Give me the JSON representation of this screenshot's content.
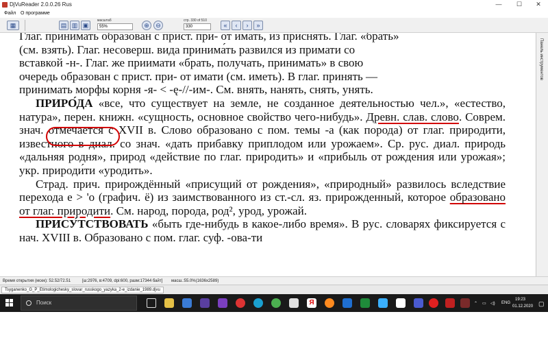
{
  "window": {
    "title": "DjVuReader 2.0.0.26 Rus"
  },
  "menu": {
    "file": "Файл",
    "about": "О программе"
  },
  "toolbar": {
    "zoom_label": "масштаб",
    "zoom_value": "55%",
    "page_label": "стр. 330 of 510",
    "page_value": "330"
  },
  "side_panel": {
    "label": "Панель инструментов"
  },
  "document": {
    "lines": [
      "Глаг. принимать образован с прист. при- от имать, из приснять. Глаг. «брать»",
      "(см. взять). Глаг. несоверш. вида принима́ть развился из примати со",
      "вставкой -н-. Глаг. же приимати «брать, получать, принимать» в свою",
      "очередь образован с прист. при- от имати (см. иметь). В глаг. принять —",
      "принимать морфы корня -я- < -ę-//-им-. См. внять, нанять, снять, унять."
    ],
    "entry1": {
      "headword": "ПРИРО́ДА",
      "text_a": "«все, что существует на земле, не созданное деятельностью чел.», «естество, натура», перен. книжн. «сущность, основное свойство чего-нибудь». ",
      "underlined": "Древн. слав. слово",
      "text_b": ". Соврем. знач. отмечается с XVII в. Слово образовано с пом. темы -а (как порода) от глаг. природити, известного в диал. со знач. «дать прибавку приплодом или урожаем». Ср. рус. диал. природь «дальняя родня», природ «действие по глаг. природить» и «прибыль от рождения или урожая»; укр. природи́ти «уродить»."
    },
    "entry2": {
      "text_a": "Страд. прич. прирождённый «присущий от рождения», «природный» развилось вследствие перехода е > 'о (графич. ё) из заимствованного из ст.-сл. яз. прирожденный, которое ",
      "underlined": "образовано от глаг. природити",
      "text_b": ". См. народ, порода, род², урод, урожай."
    },
    "entry3": {
      "headword": "ПРИСУ́ТСТВОВАТЬ",
      "text": "«быть где-нибудь в какое-либо время». В рус. словарях фиксируется с нач. XVIII в. Образовано с пом. глаг. суф. -ова-ти"
    }
  },
  "status": {
    "open_time": "Время открытия (мсек): 52.52/72.51",
    "page_info": "[ш:2976, в:4709, dpi:600, разм:17344 байт]",
    "zoom_info": "масш.:55.0%(1636x2589)"
  },
  "file_tab": {
    "name": "Tsyganenko_G_P_Etimologichesky_slovar_russkogo_yazyka_2-e_izdanie_1989.djvu"
  },
  "taskbar": {
    "search_placeholder": "Поиск",
    "lang": "ENG",
    "time": "19:23",
    "date": "01.12.2020"
  },
  "colors": {
    "annotation": "#d10000",
    "taskbar": "#1a1a1a",
    "toolbar_icon": "#2a4a8a"
  }
}
